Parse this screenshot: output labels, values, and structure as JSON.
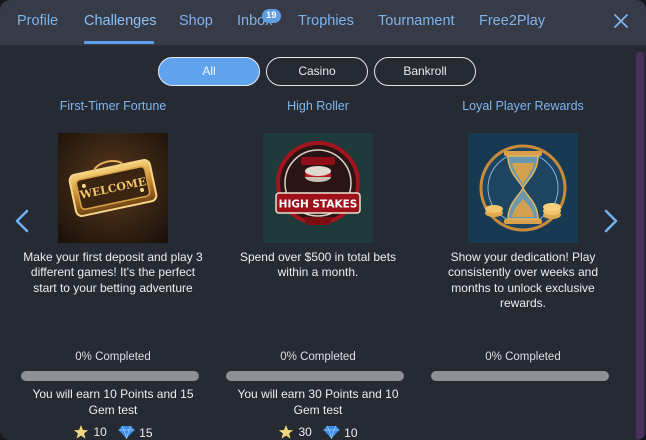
{
  "nav": {
    "tabs": [
      {
        "label": "Profile",
        "active": false
      },
      {
        "label": "Challenges",
        "active": true
      },
      {
        "label": "Shop",
        "active": false
      },
      {
        "label": "Inbox",
        "active": false,
        "badge": "19"
      },
      {
        "label": "Trophies",
        "active": false
      },
      {
        "label": "Tournament",
        "active": false
      },
      {
        "label": "Free2Play",
        "active": false
      }
    ],
    "close_icon": "close-icon"
  },
  "filters": [
    {
      "label": "All",
      "active": true
    },
    {
      "label": "Casino",
      "active": false
    },
    {
      "label": "Bankroll",
      "active": false
    }
  ],
  "carousel": {
    "prev_icon": "chevron-left-icon",
    "next_icon": "chevron-right-icon"
  },
  "challenges": [
    {
      "title": "First-Timer Fortune",
      "image_icon": "welcome-sign-icon",
      "image_text": "WELCOME",
      "description": "Make your first deposit and play 3 different games! It's the perfect start to your betting adventure",
      "progress_label": "0% Completed",
      "progress": 0,
      "reward_text": "You will earn 10 Points and 15 Gem test",
      "points": "10",
      "gems": "15"
    },
    {
      "title": "High Roller",
      "image_icon": "high-stakes-badge-icon",
      "image_text": "HIGH STAKES",
      "description": "Spend over $500 in total bets within a month.",
      "progress_label": "0% Completed",
      "progress": 0,
      "reward_text": "You will earn 30 Points and 10 Gem test",
      "points": "30",
      "gems": "10"
    },
    {
      "title": "Loyal Player Rewards",
      "image_icon": "hourglass-coins-icon",
      "image_text": "",
      "description": "Show your dedication! Play consistently over weeks and months to unlock exclusive rewards.",
      "progress_label": "0% Completed",
      "progress": 0,
      "reward_text": "",
      "points": "",
      "gems": ""
    }
  ],
  "colors": {
    "accent": "#5fa3ef",
    "link": "#7fb6ef",
    "panel": "#262a33",
    "nav": "#363b47",
    "star": "#f0d67c",
    "gem": "#3b8be8"
  }
}
